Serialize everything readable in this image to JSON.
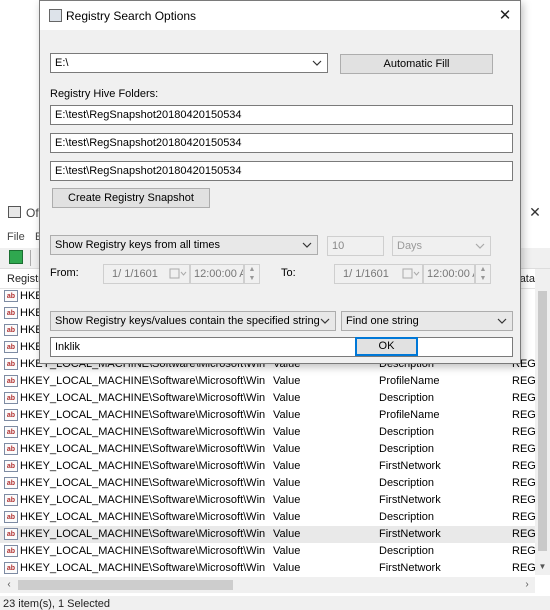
{
  "dialog": {
    "title": "Registry Search Options",
    "drive_value": "E:\\",
    "automatic_fill_label": "Automatic Fill",
    "hive_folders_label": "Registry Hive Folders:",
    "hive_folders": [
      "E:\\test\\RegSnapshot20180420150534",
      "E:\\test\\RegSnapshot20180420150534",
      "E:\\test\\RegSnapshot20180420150534"
    ],
    "create_snapshot_label": "Create Registry Snapshot",
    "time_filter_value": "Show Registry keys from all times",
    "time_count": "10",
    "time_unit": "Days",
    "from_label": "From:",
    "to_label": "To:",
    "from_date": "1/  1/1601",
    "from_time": "12:00:00 AM",
    "to_date": "1/  1/1601",
    "to_time": "12:00:00 AM",
    "string_filter_value": "Show Registry keys/values contain the specified string",
    "find_mode_value": "Find one string",
    "search_text": "Inklik",
    "ok_label": "OK"
  },
  "background": {
    "title": "Of",
    "menu": [
      "File",
      "E"
    ],
    "columns": [
      "Registry",
      "Data"
    ],
    "rows": [
      {
        "key": "HKEY",
        "type": "",
        "name": "",
        "data": ""
      },
      {
        "key": "HKEY",
        "type": "",
        "name": "",
        "data": ""
      },
      {
        "key": "HKEY",
        "type": "",
        "name": "",
        "data": ""
      },
      {
        "key": "HKEY",
        "type": "",
        "name": "",
        "data": ""
      },
      {
        "key": "HKEY_LOCAL_MACHINE\\Software\\Microsoft\\Win...",
        "type": "Value",
        "name": "Description",
        "data": "REG_S"
      },
      {
        "key": "HKEY_LOCAL_MACHINE\\Software\\Microsoft\\Win...",
        "type": "Value",
        "name": "ProfileName",
        "data": "REG_S"
      },
      {
        "key": "HKEY_LOCAL_MACHINE\\Software\\Microsoft\\Win...",
        "type": "Value",
        "name": "Description",
        "data": "REG_S"
      },
      {
        "key": "HKEY_LOCAL_MACHINE\\Software\\Microsoft\\Win...",
        "type": "Value",
        "name": "ProfileName",
        "data": "REG_S"
      },
      {
        "key": "HKEY_LOCAL_MACHINE\\Software\\Microsoft\\Win...",
        "type": "Value",
        "name": "Description",
        "data": "REG_S"
      },
      {
        "key": "HKEY_LOCAL_MACHINE\\Software\\Microsoft\\Win...",
        "type": "Value",
        "name": "Description",
        "data": "REG_S"
      },
      {
        "key": "HKEY_LOCAL_MACHINE\\Software\\Microsoft\\Win...",
        "type": "Value",
        "name": "FirstNetwork",
        "data": "REG_S"
      },
      {
        "key": "HKEY_LOCAL_MACHINE\\Software\\Microsoft\\Win...",
        "type": "Value",
        "name": "Description",
        "data": "REG_S"
      },
      {
        "key": "HKEY_LOCAL_MACHINE\\Software\\Microsoft\\Win...",
        "type": "Value",
        "name": "FirstNetwork",
        "data": "REG_S"
      },
      {
        "key": "HKEY_LOCAL_MACHINE\\Software\\Microsoft\\Win...",
        "type": "Value",
        "name": "Description",
        "data": "REG_S"
      },
      {
        "key": "HKEY_LOCAL_MACHINE\\Software\\Microsoft\\Win...",
        "type": "Value",
        "name": "FirstNetwork",
        "data": "REG_S"
      },
      {
        "key": "HKEY_LOCAL_MACHINE\\Software\\Microsoft\\Win...",
        "type": "Value",
        "name": "Description",
        "data": "REG_S"
      },
      {
        "key": "HKEY_LOCAL_MACHINE\\Software\\Microsoft\\Win...",
        "type": "Value",
        "name": "FirstNetwork",
        "data": "REG_S"
      }
    ],
    "status": "23 item(s), 1 Selected"
  },
  "colors": {
    "dialog_bg": "#f0f0f0",
    "focus_blue": "#0078d7",
    "selected_row": "#e9e9e9"
  },
  "icons": [
    "close-icon",
    "dropdown-arrow-icon",
    "calendar-icon",
    "spin-up-icon",
    "spin-down-icon",
    "registry-string-icon",
    "add-icon"
  ]
}
